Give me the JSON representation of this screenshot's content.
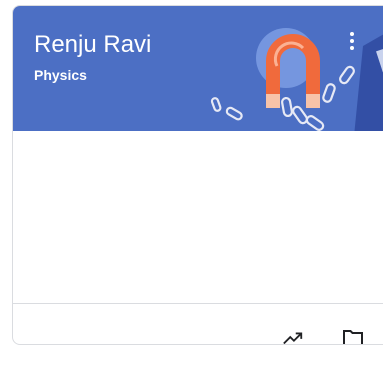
{
  "class_card": {
    "title": "Renju Ravi",
    "subtitle": "Physics",
    "banner_color": "#4c6fc4",
    "illustration": "magnet-with-paperclips",
    "more_icon": "more-vert-icon",
    "footer_icons": [
      "trending-up-icon",
      "folder-icon"
    ]
  }
}
